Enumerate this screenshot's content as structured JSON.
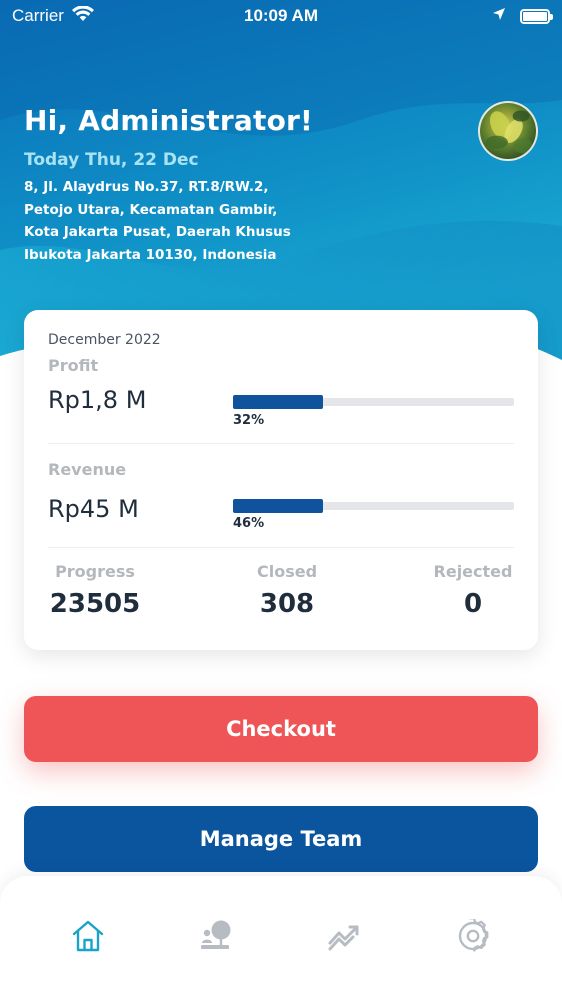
{
  "status_bar": {
    "carrier": "Carrier",
    "time": "10:09 AM"
  },
  "header": {
    "greeting": "Hi, Administrator!",
    "date": "Today Thu, 22 Dec",
    "address_lines": [
      "8, Jl. Alaydrus No.37, RT.8/RW.2,",
      "Petojo Utara, Kecamatan Gambir,",
      "Kota Jakarta Pusat, Daerah Khusus",
      "Ibukota Jakarta 10130, Indonesia"
    ]
  },
  "stats_card": {
    "period": "December 2022",
    "profit": {
      "label": "Profit",
      "value": "Rp1,8 M",
      "percent_label": "32%",
      "progress": 0.32
    },
    "revenue": {
      "label": "Revenue",
      "value": "Rp45 M",
      "percent_label": "46%",
      "progress": 0.32
    },
    "counts": [
      {
        "label": "Progress",
        "value": "23505"
      },
      {
        "label": "Closed",
        "value": "308"
      },
      {
        "label": "Rejected",
        "value": "0"
      }
    ]
  },
  "buttons": {
    "checkout_label": "Checkout",
    "manage_team_label": "Manage Team"
  },
  "bottom_nav": {
    "items": [
      {
        "icon": "home-icon",
        "active": true
      },
      {
        "icon": "user-tree-icon",
        "active": false
      },
      {
        "icon": "trend-chart-icon",
        "active": false
      },
      {
        "icon": "settings-gear-icon",
        "active": false
      }
    ]
  },
  "colors": {
    "header_gradient_top": "#0a6fb8",
    "header_gradient_bottom": "#17a6cf",
    "checkout": "#ef5556",
    "manage_team": "#0b559f",
    "progress_fill": "#0f539c",
    "nav_active": "#1aa3c8",
    "nav_inactive": "#b7bcc2"
  }
}
